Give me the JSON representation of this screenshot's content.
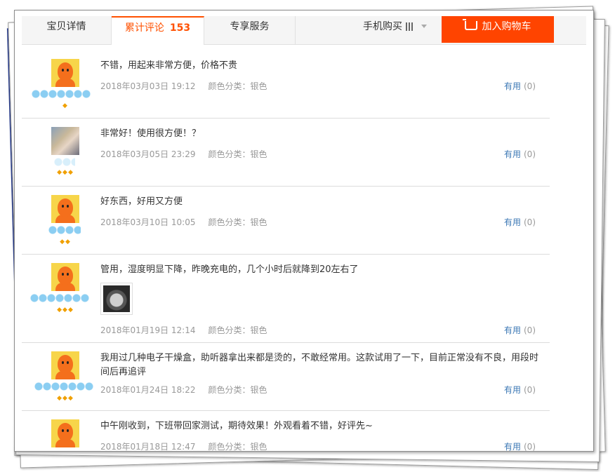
{
  "tabs": {
    "details": "宝贝详情",
    "reviews": "累计评论",
    "review_count": "153",
    "service": "专享服务",
    "mobile_buy": "手机购买",
    "add_to_cart": "加入购物车"
  },
  "reviews": [
    {
      "content": "不错，用起来非常方便，价格不贵",
      "date": "2018年03月03日 19:12",
      "color": "颜色分类：银色",
      "useful_label": "有用",
      "useful_count": "(0)",
      "avatar": "mascot",
      "rank_gems": "◆"
    },
    {
      "content": "非常好！使用很方便！？",
      "date": "2018年03月05日 23:29",
      "color": "颜色分类：银色",
      "useful_label": "有用",
      "useful_count": "(0)",
      "avatar": "photo",
      "rank_gems": "◆◆◆"
    },
    {
      "content": "好东西，好用又方便",
      "date": "2018年03月10日 10:05",
      "color": "颜色分类：银色",
      "useful_label": "有用",
      "useful_count": "(0)",
      "avatar": "mascot",
      "rank_gems": "◆◆"
    },
    {
      "content": "管用，湿度明显下降，昨晚充电的，几个小时后就降到20左右了",
      "date": "2018年01月19日 12:14",
      "color": "颜色分类：银色",
      "useful_label": "有用",
      "useful_count": "(0)",
      "avatar": "mascot",
      "rank_gems": "◆◆◆",
      "has_photo": true
    },
    {
      "content": "我用过几种电子干燥盒，助听器拿出来都是烫的，不敢经常用。这款试用了一下，目前正常没有不良，用段时间后再追评",
      "date": "2018年01月24日 18:22",
      "color": "颜色分类：银色",
      "useful_label": "有用",
      "useful_count": "(0)",
      "avatar": "mascot",
      "rank_gems": "◆◆◆"
    },
    {
      "content": "中午刚收到，下班带回家测试，期待效果！外观看着不错，好评先~",
      "date": "2018年01月18日 12:47",
      "color": "颜色分类：银色",
      "useful_label": "有用",
      "useful_count": "(0)",
      "avatar": "mascot",
      "rank_gems": ""
    }
  ],
  "colors": {
    "accent": "#ff5000",
    "cart_button": "#ff4400",
    "link": "#3c78b5",
    "meta_text": "#999999"
  }
}
